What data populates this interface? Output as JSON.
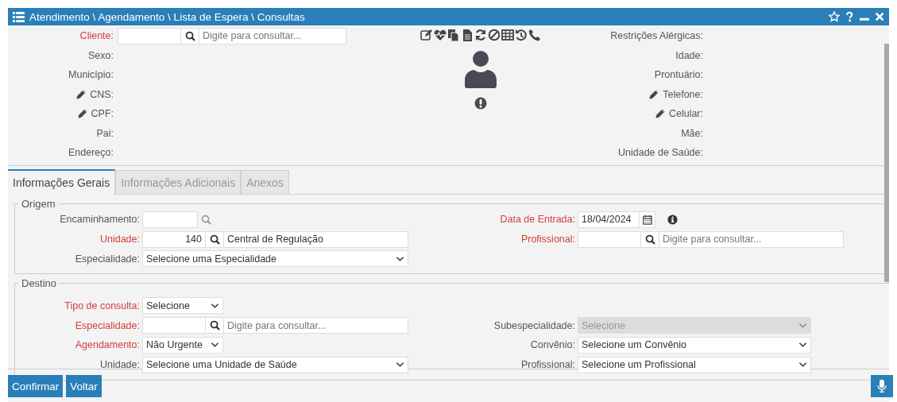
{
  "window": {
    "title": "Atendimento \\ Agendamento \\ Lista de Espera \\ Consultas"
  },
  "patient": {
    "client": {
      "label": "Cliente:",
      "required": true,
      "placeholder": "Digite para consultar..."
    },
    "left_fields": [
      {
        "label": "Sexo:",
        "editable": false
      },
      {
        "label": "Município:",
        "editable": false
      },
      {
        "label": "CNS:",
        "editable": true
      },
      {
        "label": "CPF:",
        "editable": true
      },
      {
        "label": "Pai:",
        "editable": false
      },
      {
        "label": "Endereço:",
        "editable": false
      }
    ],
    "right_fields": [
      {
        "label": "Restrições Alérgicas:",
        "editable": false
      },
      {
        "label": "Idade:",
        "editable": false
      },
      {
        "label": "Prontuário:",
        "editable": false
      },
      {
        "label": "Telefone:",
        "editable": true
      },
      {
        "label": "Celular:",
        "editable": true
      },
      {
        "label": "Mãe:",
        "editable": false
      },
      {
        "label": "Unidade de Saúde:",
        "editable": false
      }
    ]
  },
  "tabs": [
    {
      "label": "Informações Gerais",
      "selected": true
    },
    {
      "label": "Informações Adicionais",
      "selected": false
    },
    {
      "label": "Anexos",
      "selected": false
    }
  ],
  "sections": [
    {
      "legend": "Origem",
      "rows": [
        {
          "left": {
            "kind": "bare",
            "label": "Encaminhamento:",
            "required": false
          },
          "right": {
            "kind": "date",
            "label": "Data de Entrada:",
            "required": true,
            "value": "18/04/2024"
          }
        },
        {
          "left": {
            "kind": "lookup",
            "label": "Unidade:",
            "required": true,
            "code": "140",
            "value": "Central de Regulação"
          },
          "right": {
            "kind": "lookup",
            "label": "Profissional:",
            "required": true,
            "placeholder": "Digite para consultar..."
          }
        },
        {
          "left": {
            "kind": "select",
            "label": "Especialidade:",
            "required": false,
            "value": "Selecione uma Especialidade"
          }
        }
      ]
    },
    {
      "legend": "Destino",
      "rows": [
        {
          "left": {
            "kind": "short",
            "label": "Tipo de consulta:",
            "required": true,
            "value": "Selecione"
          }
        },
        {
          "left": {
            "kind": "lookup",
            "label": "Especialidade:",
            "required": true,
            "placeholder": "Digite para consultar..."
          },
          "right": {
            "kind": "select",
            "label": "Subespecialidade:",
            "required": false,
            "disabled": true,
            "value": "Selecione"
          }
        },
        {
          "left": {
            "kind": "short",
            "label": "Agendamento:",
            "required": true,
            "value": "Não Urgente"
          },
          "right": {
            "kind": "select",
            "label": "Convênio:",
            "required": false,
            "value": "Selecione um Convênio"
          }
        },
        {
          "left": {
            "kind": "select",
            "label": "Unidade:",
            "required": false,
            "value": "Selecione uma Unidade de Saúde"
          },
          "right": {
            "kind": "select",
            "label": "Profissional:",
            "required": false,
            "value": "Selecione um Profissional"
          }
        }
      ]
    }
  ],
  "buttons": [
    "Confirmar",
    "Voltar"
  ]
}
